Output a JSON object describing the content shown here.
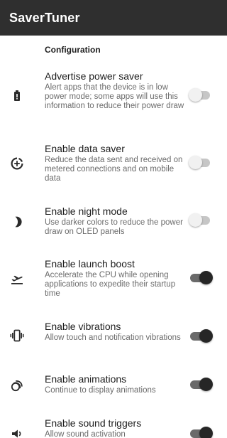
{
  "appbar": {
    "title": "SaverTuner"
  },
  "section": {
    "header": "Configuration"
  },
  "settings": [
    {
      "icon": "battery-icon",
      "title": "Advertise power saver",
      "desc": "Alert apps that the device is in low power mode; some apps will use this information to reduce their power draw",
      "enabled": false
    },
    {
      "icon": "data-saver-icon",
      "title": "Enable data saver",
      "desc": "Reduce the data sent and received on metered connections and on mobile data",
      "enabled": false
    },
    {
      "icon": "moon-icon",
      "title": "Enable night mode",
      "desc": "Use darker colors to reduce the power draw on OLED panels",
      "enabled": false
    },
    {
      "icon": "takeoff-icon",
      "title": "Enable launch boost",
      "desc": "Accelerate the CPU while opening applications to expedite their startup time",
      "enabled": true
    },
    {
      "icon": "vibration-icon",
      "title": "Enable vibrations",
      "desc": "Allow touch and notification vibrations",
      "enabled": true
    },
    {
      "icon": "animation-icon",
      "title": "Enable animations",
      "desc": "Continue to display animations",
      "enabled": true
    },
    {
      "icon": "speaker-icon",
      "title": "Enable sound triggers",
      "desc": "Allow sound activation",
      "enabled": true
    }
  ],
  "colors": {
    "appbar": "#2f2f2f",
    "switch_on_thumb": "#262626",
    "switch_on_track": "#6a6a6a",
    "switch_off_thumb": "#f1f1f1",
    "switch_off_track": "#c6c6c6"
  }
}
